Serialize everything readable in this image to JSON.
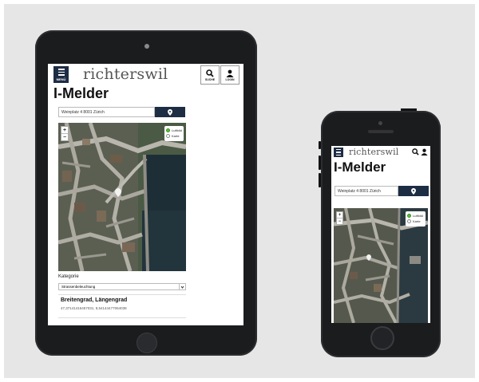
{
  "app": {
    "logo": "richterswil",
    "menu_label": "MENÜ",
    "search_label": "SUCHE",
    "login_label": "LOGIN",
    "page_title": "I-Melder"
  },
  "form": {
    "address_value": "Weinplatz 4 8001 Zürich",
    "category_label": "Kategorie",
    "category_value": "Strassenbeleuchtung",
    "coords_heading": "Breitengrad, Längengrad",
    "coords_value": "47,37141416457031, 8,54144477064038"
  },
  "map": {
    "layers": [
      {
        "label": "Luftbild",
        "selected": true
      },
      {
        "label": "Karte",
        "selected": false
      }
    ],
    "zoom_in": "+",
    "zoom_out": "−"
  },
  "colors": {
    "brand_navy": "#1d2d44",
    "logo_accent": "#7eb33a",
    "device_body": "#1b1c1e"
  },
  "icons": [
    "menu-icon",
    "search-icon",
    "user-icon",
    "map-pin-icon",
    "chevron-down-icon"
  ]
}
